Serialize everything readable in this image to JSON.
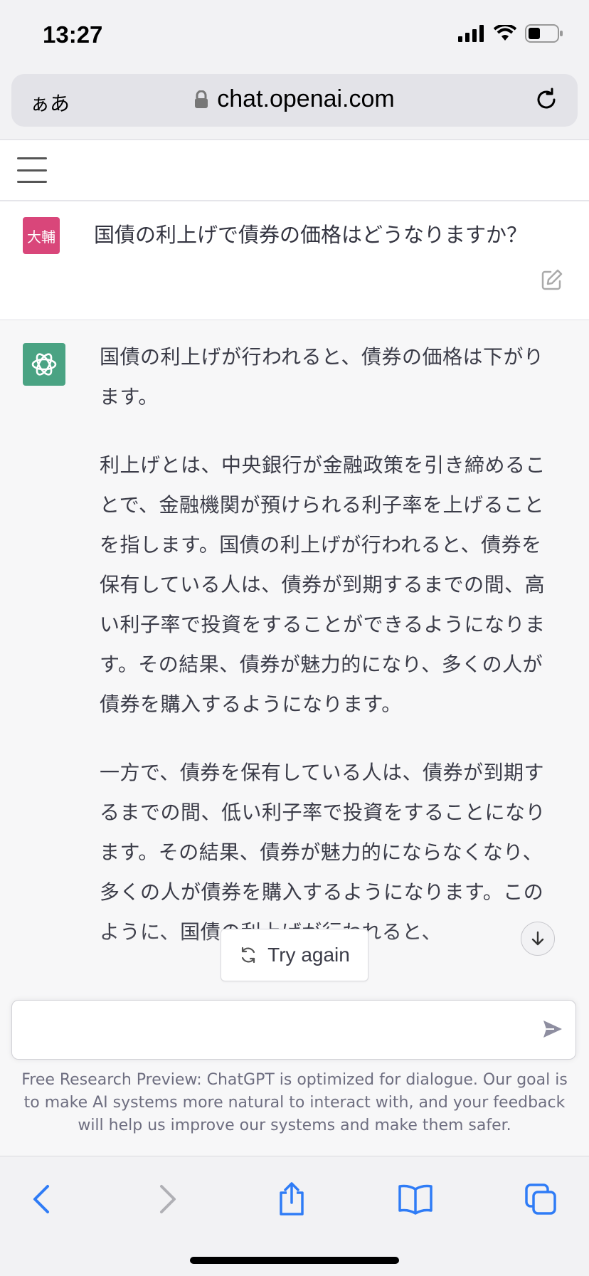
{
  "status": {
    "time": "13:27"
  },
  "browser": {
    "aa_label": "ぁあ",
    "url": "chat.openai.com"
  },
  "conversation": {
    "user_avatar_text": "大輔",
    "user_message": "国債の利上げで債券の価格はどうなりますか？",
    "assistant_paragraphs": [
      "国債の利上げが行われると、債券の価格は下がります。",
      "利上げとは、中央銀行が金融政策を引き締めることで、金融機関が預けられる利子率を上げることを指します。国債の利上げが行われると、債券を保有している人は、債券が到期するまでの間、高い利子率で投資をすることができるようになります。その結果、債券が魅力的になり、多くの人が債券を購入するようになります。",
      "一方で、債券を保有している人は、債券が到期するまでの間、低い利子率で投資をすることになります。その結果、債券が魅力的にならなくなり、多くの人が債券を購入するようになります。このように、国債の利上げが行われると、"
    ],
    "try_again_label": "Try again"
  },
  "composer": {
    "input_value": "",
    "footer_note": "Free Research Preview: ChatGPT is optimized for dialogue. Our goal is to make AI systems more natural to interact with, and your feedback will help us improve our systems and make them safer."
  },
  "colors": {
    "user_avatar": "#d9467a",
    "assistant_avatar": "#4aa383",
    "ios_blue": "#2f7cf6"
  },
  "icons": [
    "signal-icon",
    "wifi-icon",
    "battery-icon",
    "lock-icon",
    "reload-icon",
    "menu-icon",
    "edit-icon",
    "openai-logo-icon",
    "refresh-icon",
    "arrow-down-icon",
    "send-icon",
    "back-icon",
    "forward-icon",
    "share-icon",
    "bookmarks-icon",
    "tabs-icon"
  ]
}
